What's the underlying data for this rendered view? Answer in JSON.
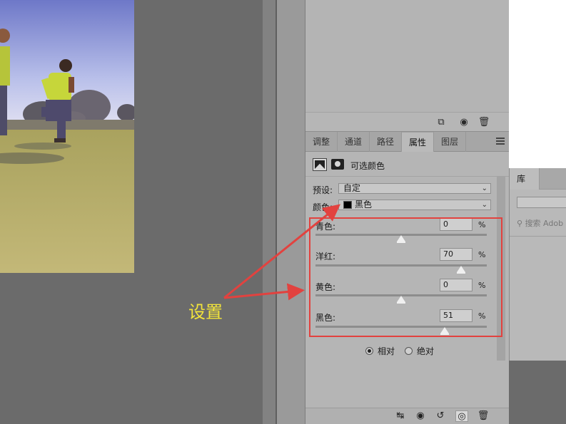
{
  "properties_panel": {
    "tabs": [
      "调整",
      "通道",
      "路径",
      "属性",
      "图层"
    ],
    "active_tab": "属性",
    "adjustment_title": "可选颜色",
    "preset_label": "预设:",
    "preset_value": "自定",
    "colors_label": "颜色:",
    "colors_value": "黑色",
    "sliders": [
      {
        "label": "青色:",
        "value": "0",
        "percent": "%",
        "level": 0
      },
      {
        "label": "洋红:",
        "value": "70",
        "percent": "%",
        "level": 70
      },
      {
        "label": "黄色:",
        "value": "0",
        "percent": "%",
        "level": 0
      },
      {
        "label": "黑色:",
        "value": "51",
        "percent": "%",
        "level": 51
      }
    ],
    "method_relative": "相对",
    "method_absolute": "绝对",
    "method_selected": "relative"
  },
  "library_panel": {
    "tab_label": "库",
    "search_placeholder": "搜索 Adob"
  },
  "annotation": {
    "text": "设置",
    "color": "#f2e43a",
    "arrow_color": "#e2423f"
  }
}
